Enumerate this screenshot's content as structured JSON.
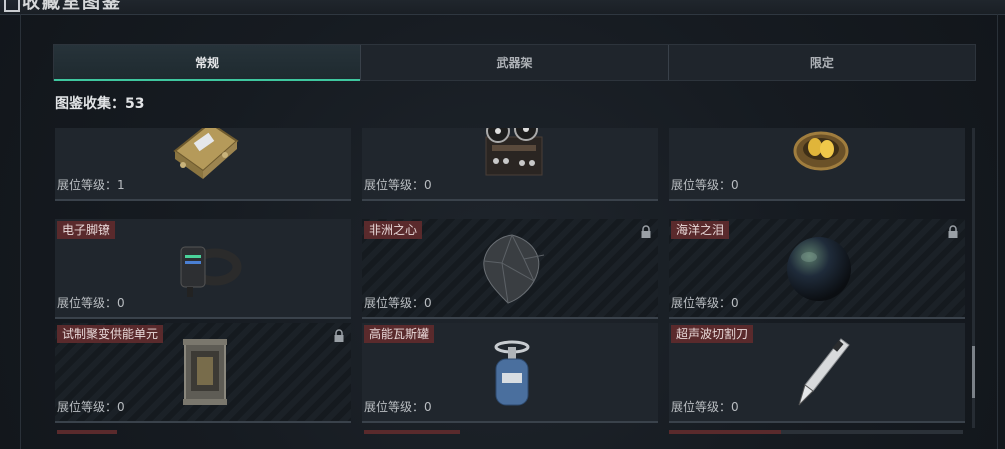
{
  "header": {
    "title": "收藏室图鉴"
  },
  "tabs": [
    {
      "label": "常规",
      "active": true
    },
    {
      "label": "武器架",
      "active": false
    },
    {
      "label": "限定",
      "active": false
    }
  ],
  "collection_text": "图鉴收集：53",
  "cards": [
    {
      "name": "",
      "level": "展位等级：1",
      "locked": false,
      "icon": "gold-device-icon"
    },
    {
      "name": "",
      "level": "展位等级：0",
      "locked": false,
      "icon": "reel-tape-recorder-icon"
    },
    {
      "name": "",
      "level": "展位等级：0",
      "locked": false,
      "icon": "golden-eggs-nest-icon"
    },
    {
      "name": "电子脚镣",
      "level": "展位等级：0",
      "locked": false,
      "icon": "electronic-ankle-monitor-icon"
    },
    {
      "name": "非洲之心",
      "level": "展位等级：0",
      "locked": true,
      "icon": "diamond-icon"
    },
    {
      "name": "海洋之泪",
      "level": "展位等级：0",
      "locked": true,
      "icon": "black-pearl-icon"
    },
    {
      "name": "试制聚变供能单元",
      "level": "展位等级：0",
      "locked": true,
      "icon": "fusion-unit-icon"
    },
    {
      "name": "高能瓦斯罐",
      "level": "展位等级：0",
      "locked": false,
      "icon": "gas-canister-icon"
    },
    {
      "name": "超声波切割刀",
      "level": "展位等级：0",
      "locked": false,
      "icon": "ultrasonic-cutter-icon"
    }
  ]
}
